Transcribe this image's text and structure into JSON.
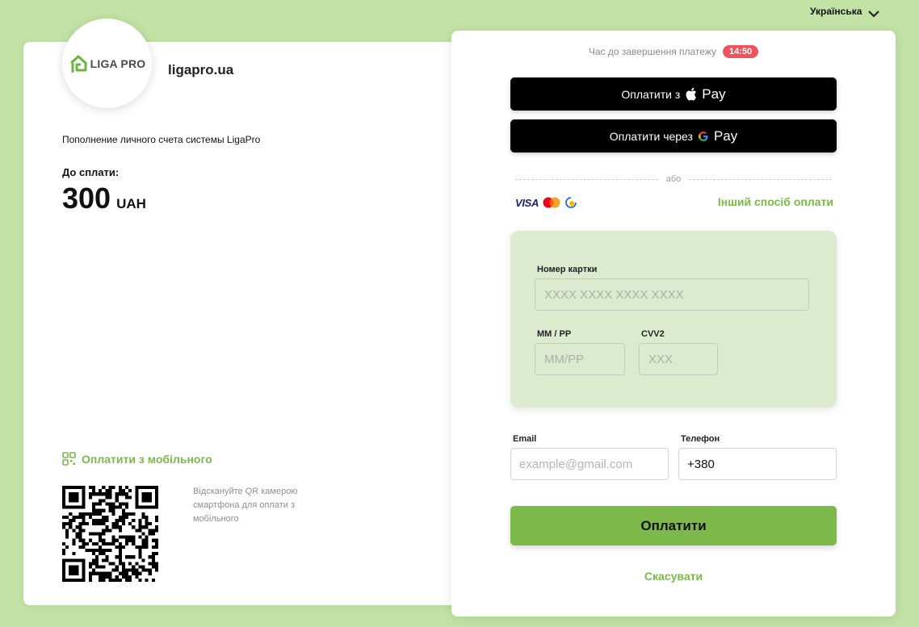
{
  "language": {
    "label": "Українська",
    "icon": "chevron-down-icon"
  },
  "merchant": {
    "logo_text": "LIGA PRO",
    "logo_icon": "liga-pro-house-icon",
    "domain": "ligapro.ua",
    "purpose": "Пополнение личного счета системы LigaPro"
  },
  "amount": {
    "label": "До сплати:",
    "value": "300",
    "currency": "UAH"
  },
  "mobile": {
    "label": "Оплатити з мобільного",
    "icon": "qr-scan-icon",
    "hint": "Відскануйте QR камерою смартфона для оплати з мобільного"
  },
  "timer": {
    "label": "Час до завершення платежу",
    "value": "14:50"
  },
  "wallets": {
    "apple_prefix": "Оплатити з",
    "google_prefix": "Оплатити через",
    "pay_word": "Pay"
  },
  "divider_label": "або",
  "card_brands": {
    "visa": "VISA",
    "mastercard_icon": "mastercard-icon",
    "prostir_icon": "prostir-icon"
  },
  "other_method": "Інший спосіб оплати",
  "card_form": {
    "number_label": "Номер картки",
    "number_placeholder": "XXXX XXXX XXXX XXXX",
    "expiry_label": "MM / PP",
    "expiry_placeholder": "MM/PP",
    "cvv_label": "CVV2",
    "cvv_placeholder": "XXX"
  },
  "contact": {
    "email_label": "Email",
    "email_placeholder": "example@gmail.com",
    "phone_label": "Телефон",
    "phone_value": "+380"
  },
  "pay_button": "Оплатити",
  "cancel": "Скасувати",
  "colors": {
    "background": "#c2e3a5",
    "accent": "#7cb94a",
    "timer_badge": "#f0535e",
    "form_bg": "#dcead0"
  }
}
